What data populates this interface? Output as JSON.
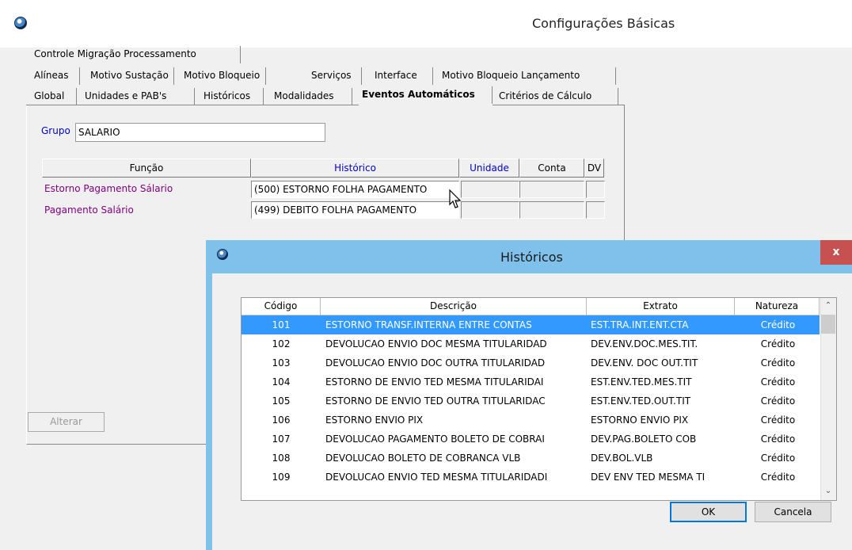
{
  "window": {
    "title": "Configurações Básicas"
  },
  "tabs": {
    "row1": [
      "Controle Migração Processamento"
    ],
    "row2": [
      "Alíneas",
      "Motivo Sustação",
      "Motivo Bloqueio",
      "Serviços",
      "Interface",
      "Motivo Bloqueio Lançamento"
    ],
    "row3": [
      "Global",
      "Unidades e PAB's",
      "Históricos",
      "Modalidades",
      "Eventos Automáticos",
      "Critérios de Cálculo"
    ],
    "active": "Eventos Automáticos"
  },
  "form": {
    "grupo_label": "Grupo",
    "grupo_value": "SALARIO"
  },
  "grid": {
    "headers": [
      "Função",
      "Histórico",
      "Unidade",
      "Conta",
      "DV"
    ],
    "rows": [
      {
        "funcao": "Estorno Pagamento Sálario",
        "historico": "(500) ESTORNO FOLHA PAGAMENTO"
      },
      {
        "funcao": "Pagamento Salário",
        "historico": "(499) DEBITO FOLHA PAGAMENTO"
      }
    ]
  },
  "buttons": {
    "alterar": "Alterar"
  },
  "dialog": {
    "title": "Históricos",
    "close": "x",
    "columns": [
      "Código",
      "Descrição",
      "Extrato",
      "Natureza"
    ],
    "rows": [
      {
        "codigo": "101",
        "descricao": "ESTORNO TRANSF.INTERNA ENTRE CONTAS",
        "extrato": "EST.TRA.INT.ENT.CTA",
        "natureza": "Crédito"
      },
      {
        "codigo": "102",
        "descricao": "DEVOLUCAO ENVIO DOC MESMA TITULARIDAD",
        "extrato": "DEV.ENV.DOC.MES.TIT.",
        "natureza": "Crédito"
      },
      {
        "codigo": "103",
        "descricao": "DEVOLUCAO  ENVIO DOC OUTRA TITULARIDAD",
        "extrato": "DEV.ENV. DOC OUT.TIT",
        "natureza": "Crédito"
      },
      {
        "codigo": "104",
        "descricao": "ESTORNO DE ENVIO TED  MESMA TITULARIDAI",
        "extrato": "EST.ENV.TED.MES.TIT",
        "natureza": "Crédito"
      },
      {
        "codigo": "105",
        "descricao": "ESTORNO DE ENVIO TED OUTRA TITULARIDAC",
        "extrato": "EST.ENV.TED.OUT.TIT",
        "natureza": "Crédito"
      },
      {
        "codigo": "106",
        "descricao": "ESTORNO ENVIO PIX",
        "extrato": "ESTORNO ENVIO PIX",
        "natureza": "Crédito"
      },
      {
        "codigo": "107",
        "descricao": "DEVOLUCAO PAGAMENTO  BOLETO DE COBRAI",
        "extrato": "DEV.PAG.BOLETO COB",
        "natureza": "Crédito"
      },
      {
        "codigo": "108",
        "descricao": "DEVOLUCAO BOLETO DE COBRANCA VLB",
        "extrato": "DEV.BOL.VLB",
        "natureza": "Crédito"
      },
      {
        "codigo": "109",
        "descricao": "DEVOLUCAO ENVIO TED MESMA TITULARIDADI",
        "extrato": "DEV ENV TED MESMA TI",
        "natureza": "Crédito"
      }
    ],
    "selected_index": 0,
    "ok": "OK",
    "cancel": "Cancela"
  },
  "colors": {
    "selection": "#3399ff",
    "dialog_frame": "#7fc1ea",
    "link_blue": "#0000c8",
    "purple": "#800080",
    "close_red": "#c75050"
  }
}
